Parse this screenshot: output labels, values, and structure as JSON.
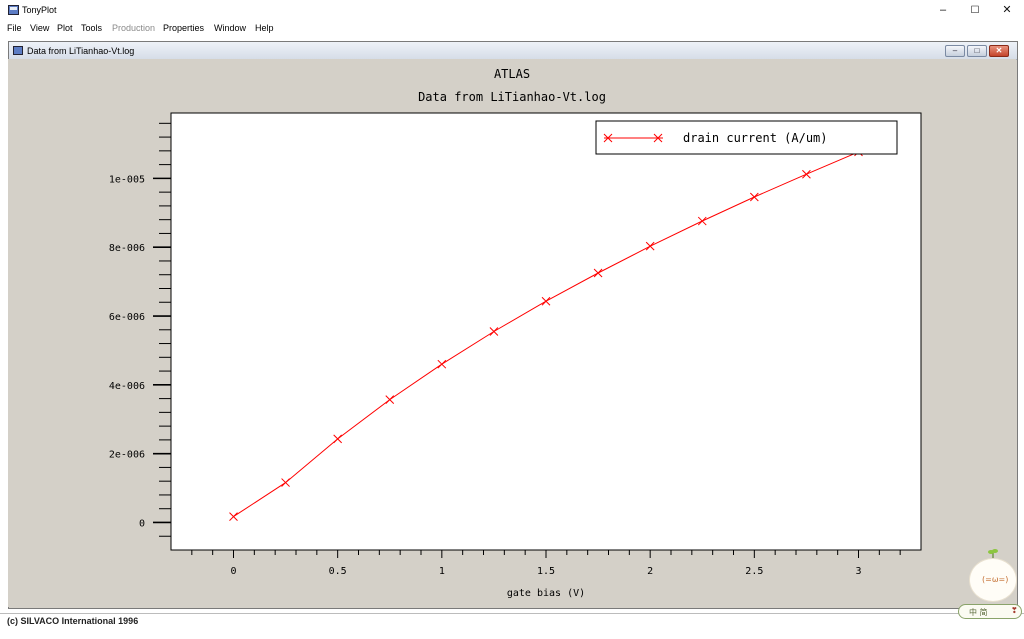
{
  "app": {
    "title": "TonyPlot"
  },
  "window_controls": {
    "minimize": "–",
    "maximize": "☐",
    "close": "✕"
  },
  "menu": [
    "File",
    "View",
    "Plot",
    "Tools",
    "Production",
    "Properties",
    "Window",
    "Help"
  ],
  "menu_disabled": [
    "Production"
  ],
  "child_window": {
    "title": "Data from LiTianhao-Vt.log",
    "controls": {
      "minimize": "–",
      "maximize": "□",
      "close": "✕"
    }
  },
  "plot": {
    "header": "ATLAS",
    "subheader": "Data from LiTianhao-Vt.log",
    "background_color": "#d4d0c8",
    "plot_area_color": "#ffffff",
    "series_color": "#ff0000",
    "x_tick_labels": [
      "0",
      "0.5",
      "1",
      "1.5",
      "2",
      "2.5",
      "3"
    ],
    "y_tick_labels": [
      "0",
      "2e-006",
      "4e-006",
      "6e-006",
      "8e-006",
      "1e-005"
    ]
  },
  "chart_data": {
    "type": "line",
    "xlabel": "gate bias (V)",
    "ylabel": "",
    "xlim": [
      -0.3,
      3.3
    ],
    "ylim": [
      -8e-07,
      1.19e-05
    ],
    "x_ticks": [
      0,
      0.5,
      1,
      1.5,
      2,
      2.5,
      3
    ],
    "y_ticks": [
      0,
      2e-06,
      4e-06,
      6e-06,
      8e-06,
      1e-05
    ],
    "grid": false,
    "legend_position": "top-right",
    "series": [
      {
        "name": "drain current (A/um)",
        "color": "#ff0000",
        "marker": "x",
        "x": [
          0,
          0.25,
          0.5,
          0.75,
          1.0,
          1.25,
          1.5,
          1.75,
          2.0,
          2.25,
          2.5,
          2.75,
          3.0
        ],
        "y": [
          1.7e-07,
          1.16e-06,
          2.43e-06,
          3.57e-06,
          4.6e-06,
          5.55e-06,
          6.43e-06,
          7.25e-06,
          8.03e-06,
          8.76e-06,
          9.46e-06,
          1.012e-05,
          1.077e-05
        ]
      }
    ]
  },
  "status": {
    "text": "(c) SILVACO International 1996"
  },
  "ime": {
    "face": "(=ω=)",
    "bar": "中  简",
    "bar_extra": "❣"
  }
}
